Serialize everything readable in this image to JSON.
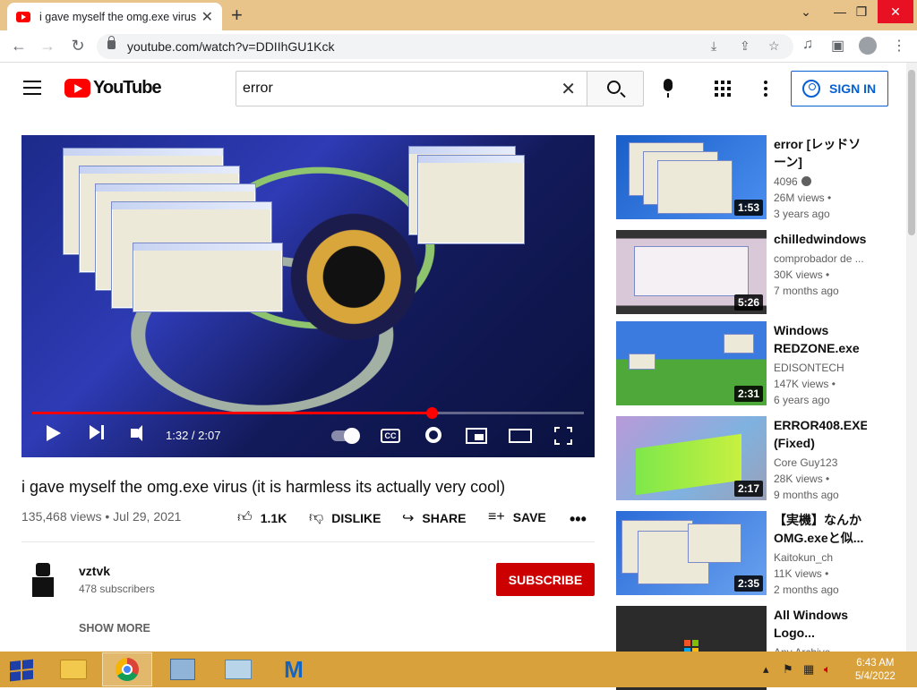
{
  "browser": {
    "tab_title": "i gave myself the omg.exe virus (",
    "tab_close": "✕",
    "new_tab": "+",
    "url": "youtube.com/watch?v=DDIIhGU1Kck",
    "window_controls": {
      "minimize": "—",
      "maximize": "❐",
      "close": "✕",
      "dropdown": "⌄"
    }
  },
  "header": {
    "logo_text": "YouTube",
    "search_value": "error",
    "search_clear": "✕",
    "signin_label": "SIGN IN"
  },
  "player": {
    "time": "1:32 / 2:07",
    "progress_fraction": 0.724,
    "cc_label": "CC"
  },
  "video": {
    "title": "i gave myself the omg.exe virus (it is harmless its actually very cool)",
    "meta": "135,468 views • Jul 29, 2021",
    "like_label": "1.1K",
    "dislike_label": "DISLIKE",
    "share_label": "SHARE",
    "save_label": "SAVE",
    "more": "•••"
  },
  "channel": {
    "name": "vztvk",
    "subscribers": "478 subscribers",
    "subscribe_label": "SUBSCRIBE",
    "show_more": "SHOW MORE"
  },
  "recommendations": [
    {
      "title": "error [レッドソーン]",
      "channel": "4096",
      "views": "26M views •",
      "ago": "3 years ago",
      "duration": "1:53"
    },
    {
      "title": "chilledwindows-",
      "channel": "comprobador de ...",
      "views": "30K views •",
      "ago": "7 months ago",
      "duration": "5:26"
    },
    {
      "title": "Windows REDZONE.exe",
      "channel": "EDISONTECH",
      "views": "147K views •",
      "ago": "6 years ago",
      "duration": "2:31"
    },
    {
      "title": "ERROR408.EXE (Fixed)",
      "channel": "Core Guy123",
      "views": "28K views •",
      "ago": "9 months ago",
      "duration": "2:17"
    },
    {
      "title": "【実機】なんかOMG.exeと似...",
      "channel": "Kaitokun_ch",
      "views": "11K views •",
      "ago": "2 months ago",
      "duration": "2:35"
    },
    {
      "title": "All Windows Logo...",
      "channel": "Any Archive",
      "views": "",
      "ago": "",
      "duration": ""
    }
  ],
  "taskbar": {
    "time": "6:43 AM",
    "date": "5/4/2022"
  },
  "colors": {
    "brand_red": "#ff0000",
    "subscribe_red": "#cc0000",
    "link_blue": "#065fd4",
    "taskbar": "#d9a13c",
    "tabstrip": "#e8c48a"
  }
}
